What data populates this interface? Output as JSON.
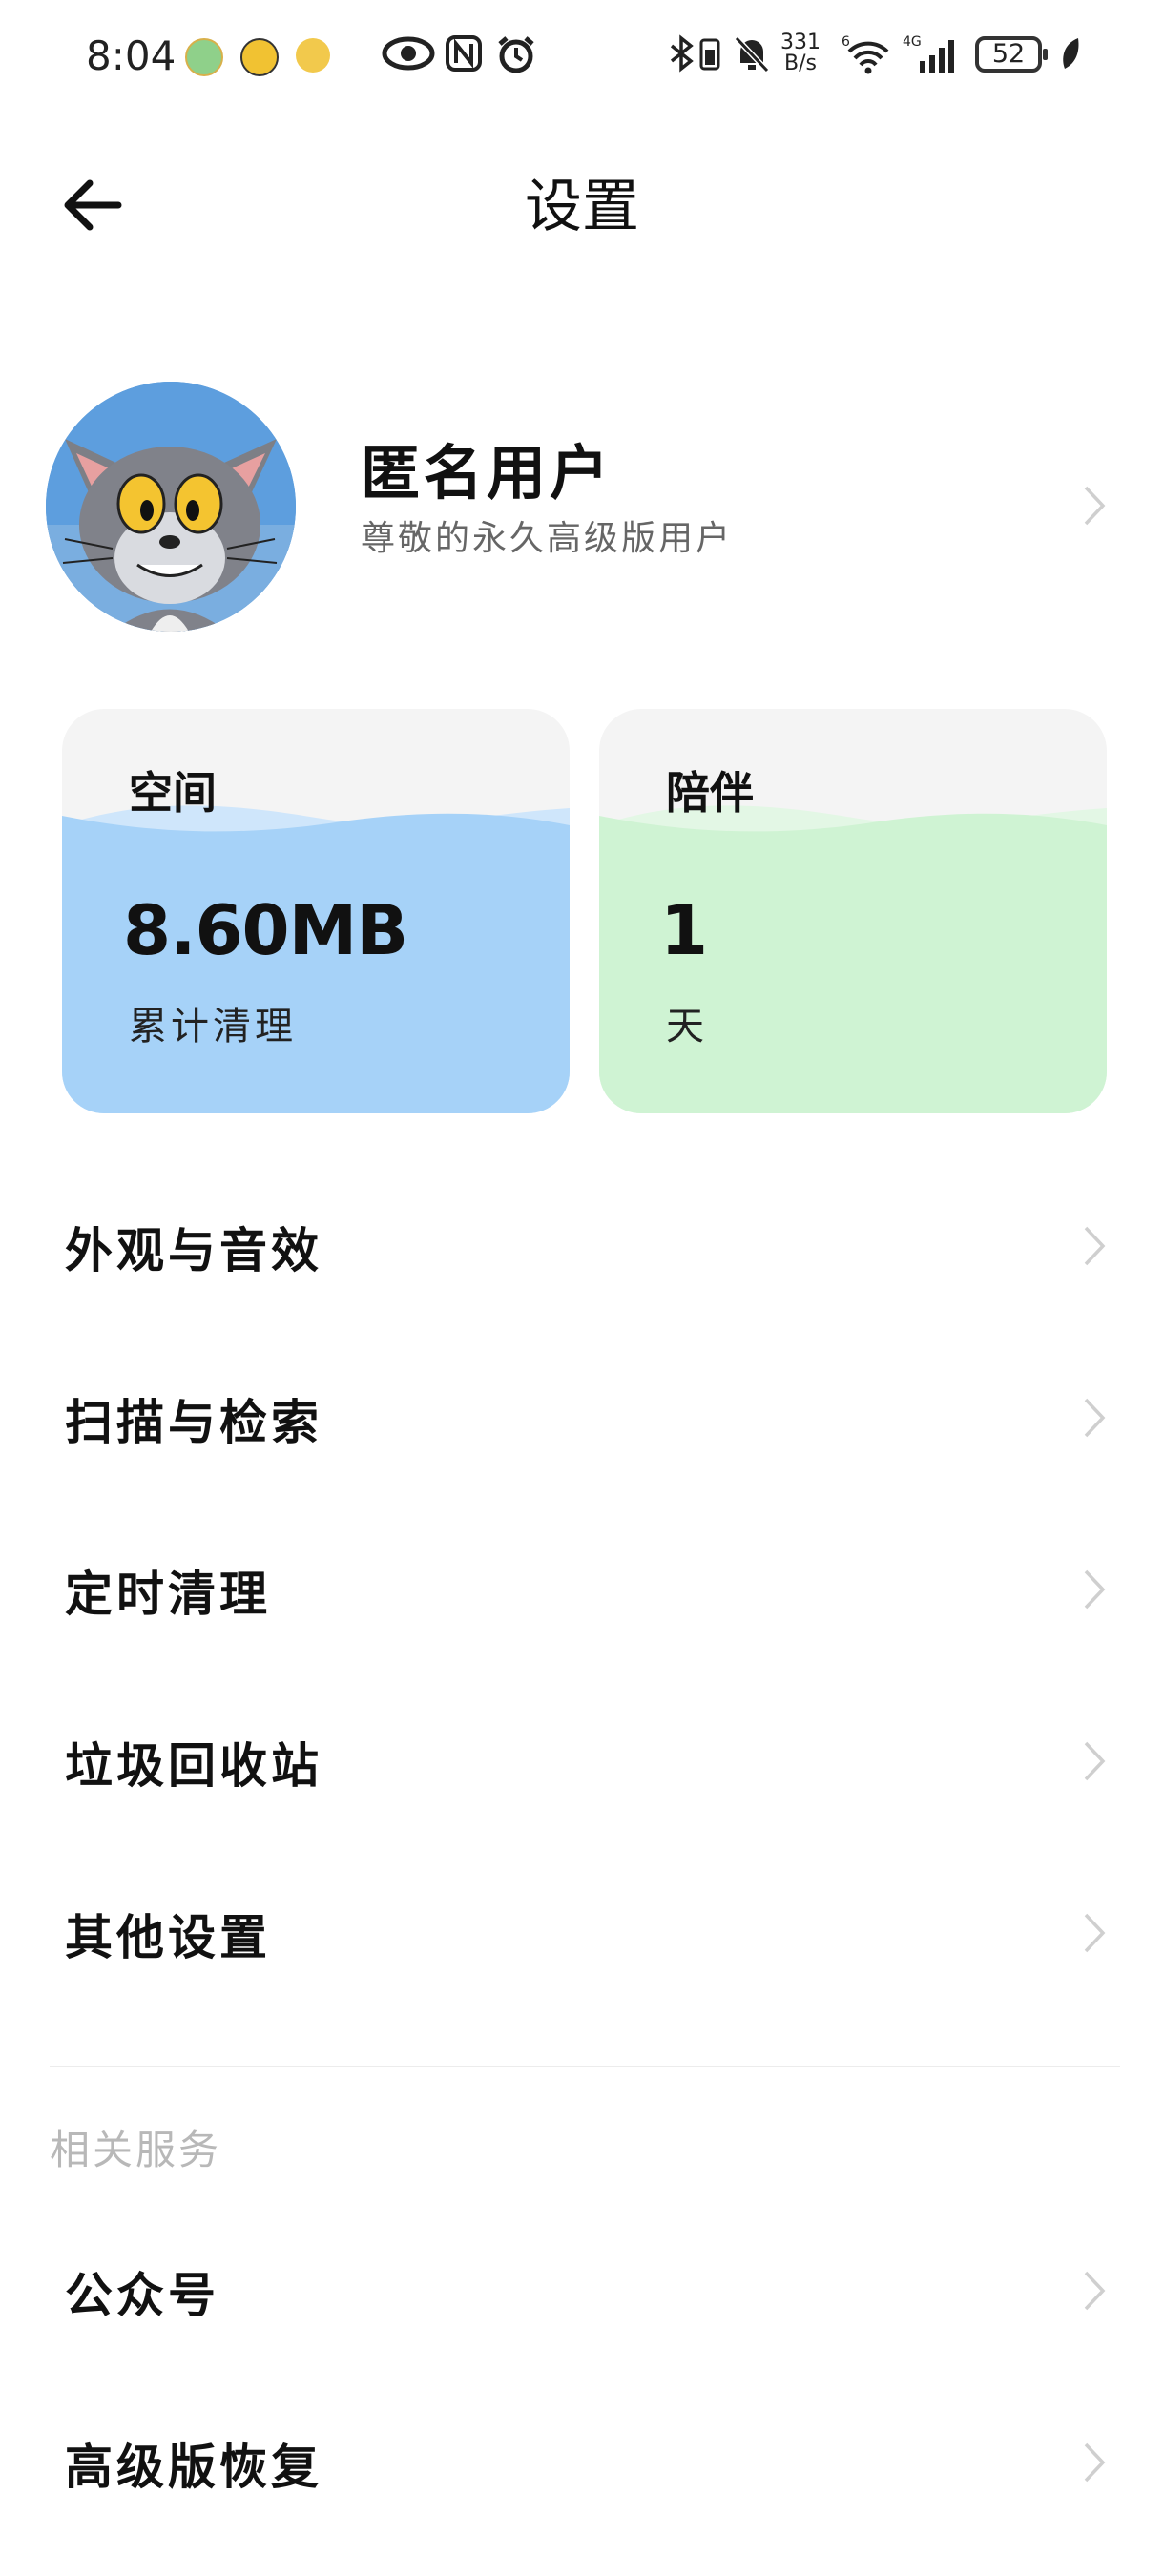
{
  "status_bar": {
    "time": "8:04",
    "net_speed_value": "331",
    "net_speed_unit": "B/s",
    "battery": "52",
    "wifi_label": "6",
    "cell_label": "4G"
  },
  "header": {
    "title": "设置"
  },
  "profile": {
    "name": "匿名用户",
    "subtitle": "尊敬的永久高级版用户"
  },
  "stats": [
    {
      "title": "空间",
      "value": "8.60MB",
      "unit": "累计清理",
      "color": "#a6d2f8",
      "wave_light": "#cfe6fb"
    },
    {
      "title": "陪伴",
      "value": "1",
      "unit": "天",
      "color": "#cff3d3",
      "wave_light": "#e3f7e5"
    }
  ],
  "menu": {
    "items": [
      {
        "label": "外观与音效"
      },
      {
        "label": "扫描与检索"
      },
      {
        "label": "定时清理"
      },
      {
        "label": "垃圾回收站"
      },
      {
        "label": "其他设置"
      }
    ]
  },
  "related": {
    "title": "相关服务",
    "items": [
      {
        "label": "公众号"
      },
      {
        "label": "高级版恢复"
      }
    ]
  },
  "icons": [
    "back-arrow-icon",
    "chevron-right-icon",
    "eye-icon",
    "nfc-icon",
    "alarm-icon",
    "bluetooth-icon",
    "mute-icon",
    "wifi-icon",
    "signal-icon",
    "battery-icon",
    "leaf-icon"
  ]
}
